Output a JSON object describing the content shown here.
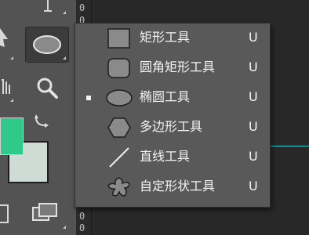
{
  "ruler": {
    "digits": [
      "0",
      "0",
      "0",
      "0",
      "0",
      "0",
      "0",
      "0"
    ]
  },
  "colors": {
    "foreground": "#2fc98a",
    "background": "#cfdcd6",
    "guide": "#39d0d6",
    "menu_bg": "#595959",
    "canvas_bg": "#282828"
  },
  "toolbar": {
    "tools": [
      {
        "name": "type-tool",
        "icon": "type-cursor-icon"
      },
      {
        "name": "path-selection-tool",
        "icon": "arrow-icon"
      },
      {
        "name": "ellipse-tool",
        "icon": "ellipse-icon",
        "active": true
      },
      {
        "name": "hand-tool",
        "icon": "hand-icon"
      },
      {
        "name": "zoom-tool",
        "icon": "magnifier-icon"
      },
      {
        "name": "swap-colors",
        "icon": "swap-arrows-icon"
      },
      {
        "name": "quick-mask",
        "icon": "quick-mask-icon"
      },
      {
        "name": "screen-mode",
        "icon": "screen-mode-icon"
      }
    ]
  },
  "shape_menu": {
    "items": [
      {
        "label": "矩形工具",
        "shortcut": "U",
        "icon": "rectangle-icon",
        "selected": false
      },
      {
        "label": "圆角矩形工具",
        "shortcut": "U",
        "icon": "rounded-rectangle-icon",
        "selected": false
      },
      {
        "label": "椭圆工具",
        "shortcut": "U",
        "icon": "ellipse-icon",
        "selected": true
      },
      {
        "label": "多边形工具",
        "shortcut": "U",
        "icon": "polygon-icon",
        "selected": false
      },
      {
        "label": "直线工具",
        "shortcut": "U",
        "icon": "line-icon",
        "selected": false
      },
      {
        "label": "自定形状工具",
        "shortcut": "U",
        "icon": "custom-shape-icon",
        "selected": false
      }
    ]
  }
}
